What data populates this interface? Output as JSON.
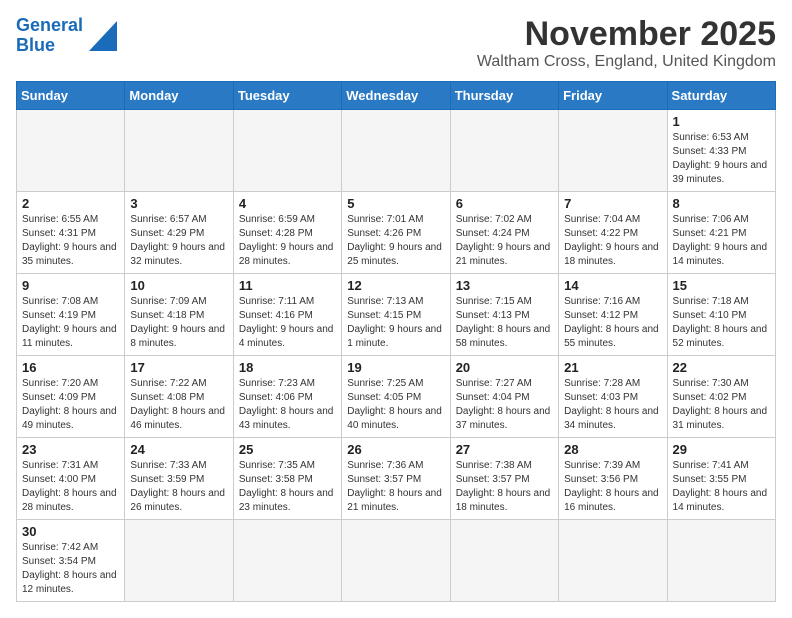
{
  "header": {
    "logo_line1": "General",
    "logo_line2": "Blue",
    "month": "November 2025",
    "location": "Waltham Cross, England, United Kingdom"
  },
  "weekdays": [
    "Sunday",
    "Monday",
    "Tuesday",
    "Wednesday",
    "Thursday",
    "Friday",
    "Saturday"
  ],
  "days": [
    {
      "date": "",
      "sunrise": "",
      "sunset": "",
      "daylight": ""
    },
    {
      "date": "",
      "sunrise": "",
      "sunset": "",
      "daylight": ""
    },
    {
      "date": "",
      "sunrise": "",
      "sunset": "",
      "daylight": ""
    },
    {
      "date": "",
      "sunrise": "",
      "sunset": "",
      "daylight": ""
    },
    {
      "date": "",
      "sunrise": "",
      "sunset": "",
      "daylight": ""
    },
    {
      "date": "",
      "sunrise": "",
      "sunset": "",
      "daylight": ""
    },
    {
      "date": "1",
      "sunrise": "Sunrise: 6:53 AM",
      "sunset": "Sunset: 4:33 PM",
      "daylight": "Daylight: 9 hours and 39 minutes."
    },
    {
      "date": "2",
      "sunrise": "Sunrise: 6:55 AM",
      "sunset": "Sunset: 4:31 PM",
      "daylight": "Daylight: 9 hours and 35 minutes."
    },
    {
      "date": "3",
      "sunrise": "Sunrise: 6:57 AM",
      "sunset": "Sunset: 4:29 PM",
      "daylight": "Daylight: 9 hours and 32 minutes."
    },
    {
      "date": "4",
      "sunrise": "Sunrise: 6:59 AM",
      "sunset": "Sunset: 4:28 PM",
      "daylight": "Daylight: 9 hours and 28 minutes."
    },
    {
      "date": "5",
      "sunrise": "Sunrise: 7:01 AM",
      "sunset": "Sunset: 4:26 PM",
      "daylight": "Daylight: 9 hours and 25 minutes."
    },
    {
      "date": "6",
      "sunrise": "Sunrise: 7:02 AM",
      "sunset": "Sunset: 4:24 PM",
      "daylight": "Daylight: 9 hours and 21 minutes."
    },
    {
      "date": "7",
      "sunrise": "Sunrise: 7:04 AM",
      "sunset": "Sunset: 4:22 PM",
      "daylight": "Daylight: 9 hours and 18 minutes."
    },
    {
      "date": "8",
      "sunrise": "Sunrise: 7:06 AM",
      "sunset": "Sunset: 4:21 PM",
      "daylight": "Daylight: 9 hours and 14 minutes."
    },
    {
      "date": "9",
      "sunrise": "Sunrise: 7:08 AM",
      "sunset": "Sunset: 4:19 PM",
      "daylight": "Daylight: 9 hours and 11 minutes."
    },
    {
      "date": "10",
      "sunrise": "Sunrise: 7:09 AM",
      "sunset": "Sunset: 4:18 PM",
      "daylight": "Daylight: 9 hours and 8 minutes."
    },
    {
      "date": "11",
      "sunrise": "Sunrise: 7:11 AM",
      "sunset": "Sunset: 4:16 PM",
      "daylight": "Daylight: 9 hours and 4 minutes."
    },
    {
      "date": "12",
      "sunrise": "Sunrise: 7:13 AM",
      "sunset": "Sunset: 4:15 PM",
      "daylight": "Daylight: 9 hours and 1 minute."
    },
    {
      "date": "13",
      "sunrise": "Sunrise: 7:15 AM",
      "sunset": "Sunset: 4:13 PM",
      "daylight": "Daylight: 8 hours and 58 minutes."
    },
    {
      "date": "14",
      "sunrise": "Sunrise: 7:16 AM",
      "sunset": "Sunset: 4:12 PM",
      "daylight": "Daylight: 8 hours and 55 minutes."
    },
    {
      "date": "15",
      "sunrise": "Sunrise: 7:18 AM",
      "sunset": "Sunset: 4:10 PM",
      "daylight": "Daylight: 8 hours and 52 minutes."
    },
    {
      "date": "16",
      "sunrise": "Sunrise: 7:20 AM",
      "sunset": "Sunset: 4:09 PM",
      "daylight": "Daylight: 8 hours and 49 minutes."
    },
    {
      "date": "17",
      "sunrise": "Sunrise: 7:22 AM",
      "sunset": "Sunset: 4:08 PM",
      "daylight": "Daylight: 8 hours and 46 minutes."
    },
    {
      "date": "18",
      "sunrise": "Sunrise: 7:23 AM",
      "sunset": "Sunset: 4:06 PM",
      "daylight": "Daylight: 8 hours and 43 minutes."
    },
    {
      "date": "19",
      "sunrise": "Sunrise: 7:25 AM",
      "sunset": "Sunset: 4:05 PM",
      "daylight": "Daylight: 8 hours and 40 minutes."
    },
    {
      "date": "20",
      "sunrise": "Sunrise: 7:27 AM",
      "sunset": "Sunset: 4:04 PM",
      "daylight": "Daylight: 8 hours and 37 minutes."
    },
    {
      "date": "21",
      "sunrise": "Sunrise: 7:28 AM",
      "sunset": "Sunset: 4:03 PM",
      "daylight": "Daylight: 8 hours and 34 minutes."
    },
    {
      "date": "22",
      "sunrise": "Sunrise: 7:30 AM",
      "sunset": "Sunset: 4:02 PM",
      "daylight": "Daylight: 8 hours and 31 minutes."
    },
    {
      "date": "23",
      "sunrise": "Sunrise: 7:31 AM",
      "sunset": "Sunset: 4:00 PM",
      "daylight": "Daylight: 8 hours and 28 minutes."
    },
    {
      "date": "24",
      "sunrise": "Sunrise: 7:33 AM",
      "sunset": "Sunset: 3:59 PM",
      "daylight": "Daylight: 8 hours and 26 minutes."
    },
    {
      "date": "25",
      "sunrise": "Sunrise: 7:35 AM",
      "sunset": "Sunset: 3:58 PM",
      "daylight": "Daylight: 8 hours and 23 minutes."
    },
    {
      "date": "26",
      "sunrise": "Sunrise: 7:36 AM",
      "sunset": "Sunset: 3:57 PM",
      "daylight": "Daylight: 8 hours and 21 minutes."
    },
    {
      "date": "27",
      "sunrise": "Sunrise: 7:38 AM",
      "sunset": "Sunset: 3:57 PM",
      "daylight": "Daylight: 8 hours and 18 minutes."
    },
    {
      "date": "28",
      "sunrise": "Sunrise: 7:39 AM",
      "sunset": "Sunset: 3:56 PM",
      "daylight": "Daylight: 8 hours and 16 minutes."
    },
    {
      "date": "29",
      "sunrise": "Sunrise: 7:41 AM",
      "sunset": "Sunset: 3:55 PM",
      "daylight": "Daylight: 8 hours and 14 minutes."
    },
    {
      "date": "30",
      "sunrise": "Sunrise: 7:42 AM",
      "sunset": "Sunset: 3:54 PM",
      "daylight": "Daylight: 8 hours and 12 minutes."
    }
  ]
}
